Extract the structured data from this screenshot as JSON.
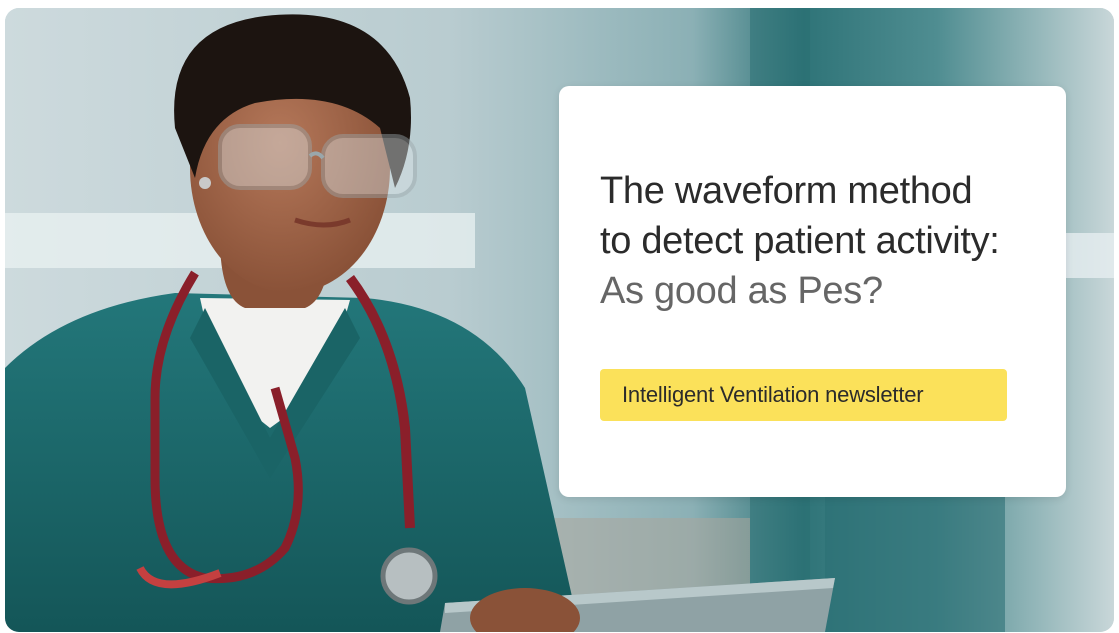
{
  "card": {
    "headline_line1": "The waveform method",
    "headline_line2": "to detect patient activity:",
    "headline_line3": "As good as Pes?",
    "tag_label": "Intelligent Ventilation newsletter"
  },
  "colors": {
    "tag_background": "#fbe15a",
    "headline_text": "#2b2b2b",
    "subheadline_text": "#666666",
    "scrubs_teal": "#1f6b6e",
    "card_background": "#ffffff"
  },
  "image": {
    "subject": "nurse-with-stethoscope-holding-tablet-photo"
  }
}
